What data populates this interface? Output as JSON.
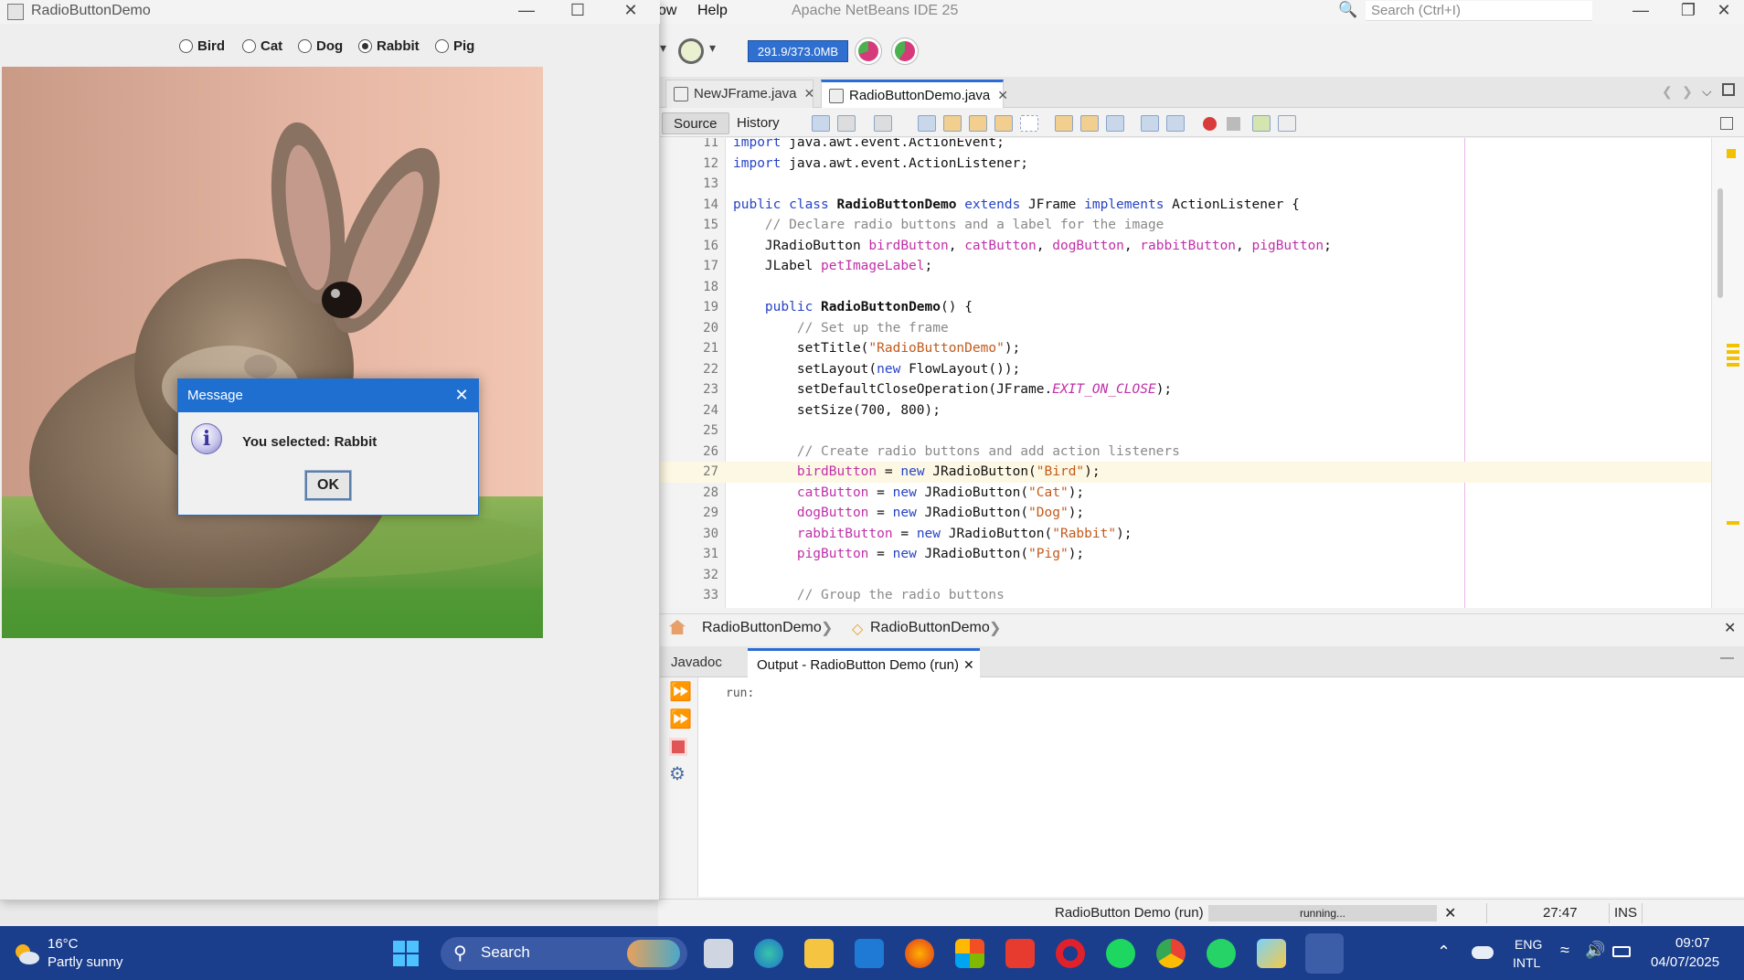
{
  "ide": {
    "menu": [
      "ow",
      "Help"
    ],
    "title": "Apache NetBeans IDE 25",
    "search_placeholder": "Search (Ctrl+I)",
    "memory": "291.9/373.0MB",
    "tabs": [
      {
        "label": "NewJFrame.java",
        "active": false
      },
      {
        "label": "RadioButtonDemo.java",
        "active": true
      }
    ],
    "editor_modes": {
      "source": "Source",
      "history": "History"
    },
    "code": [
      {
        "n": "11",
        "html": "<span class='kw'>import</span> java.awt.event.ActionEvent;"
      },
      {
        "n": "12",
        "html": "<span class='kw'>import</span> java.awt.event.ActionListener;"
      },
      {
        "n": "13",
        "html": ""
      },
      {
        "n": "14",
        "html": "<span class='kw'>public class</span> <span class='b'>RadioButtonDemo</span> <span class='kw'>extends</span> JFrame <span class='kw'>implements</span> ActionListener {"
      },
      {
        "n": "15",
        "html": "    <span class='cm'>// Declare radio buttons and a label for the image</span>"
      },
      {
        "n": "16",
        "html": "    JRadioButton <span class='fd'>birdButton</span>, <span class='fd'>catButton</span>, <span class='fd'>dogButton</span>, <span class='fd'>rabbitButton</span>, <span class='fd'>pigButton</span>;"
      },
      {
        "n": "17",
        "html": "    JLabel <span class='fd'>petImageLabel</span>;"
      },
      {
        "n": "18",
        "html": ""
      },
      {
        "n": "19",
        "html": "    <span class='kw'>public</span> <span class='b'>RadioButtonDemo</span>() {"
      },
      {
        "n": "20",
        "html": "        <span class='cm'>// Set up the frame</span>"
      },
      {
        "n": "21",
        "html": "        setTitle(<span class='st'>\"RadioButtonDemo\"</span>);"
      },
      {
        "n": "22",
        "html": "        setLayout(<span class='kw'>new</span> FlowLayout());"
      },
      {
        "n": "23",
        "html": "        setDefaultCloseOperation(JFrame.<span class='it'>EXIT_ON_CLOSE</span>);"
      },
      {
        "n": "24",
        "html": "        setSize(700, 800);"
      },
      {
        "n": "25",
        "html": ""
      },
      {
        "n": "26",
        "html": "        <span class='cm'>// Create radio buttons and add action listeners</span>"
      },
      {
        "n": "27",
        "html": "        <span class='fd'>birdButton</span> = <span class='kw'>new</span> JRadioButton(<span class='st'>\"Bird\"</span>);",
        "highlight": true
      },
      {
        "n": "28",
        "html": "        <span class='fd'>catButton</span> = <span class='kw'>new</span> JRadioButton(<span class='st'>\"Cat\"</span>);"
      },
      {
        "n": "29",
        "html": "        <span class='fd'>dogButton</span> = <span class='kw'>new</span> JRadioButton(<span class='st'>\"Dog\"</span>);"
      },
      {
        "n": "30",
        "html": "        <span class='fd'>rabbitButton</span> = <span class='kw'>new</span> JRadioButton(<span class='st'>\"Rabbit\"</span>);"
      },
      {
        "n": "31",
        "html": "        <span class='fd'>pigButton</span> = <span class='kw'>new</span> JRadioButton(<span class='st'>\"Pig\"</span>);"
      },
      {
        "n": "32",
        "html": ""
      },
      {
        "n": "33",
        "html": "        <span class='cm'>// Group the radio buttons</span>"
      }
    ],
    "breadcrumbs": [
      "RadioButtonDemo",
      "RadioButtonDemo"
    ],
    "output_tabs": [
      {
        "label": "Javadoc",
        "active": false
      },
      {
        "label": "Output - RadioButton Demo (run) ...",
        "active": true
      }
    ],
    "output_text": "run:",
    "status": {
      "task": "RadioButton Demo (run)",
      "progress_text": "running...",
      "position": "27:47",
      "mode": "INS"
    }
  },
  "demo": {
    "title": "RadioButtonDemo",
    "options": [
      {
        "label": "Bird",
        "selected": false
      },
      {
        "label": "Cat",
        "selected": false
      },
      {
        "label": "Dog",
        "selected": false
      },
      {
        "label": "Rabbit",
        "selected": true
      },
      {
        "label": "Pig",
        "selected": false
      }
    ],
    "image_icon": "rabbit-photo",
    "dialog": {
      "title": "Message",
      "message": "You selected: Rabbit",
      "ok_label": "OK"
    }
  },
  "taskbar": {
    "weather_temp": "16°C",
    "weather_desc": "Partly sunny",
    "search_label": "Search",
    "lang_top": "ENG",
    "lang_bottom": "INTL",
    "time": "09:07",
    "date": "04/07/2025",
    "apps": [
      "task-view",
      "edge",
      "file-explorer",
      "outlook",
      "firefox",
      "microsoft-store",
      "wps-office",
      "opera",
      "spotify",
      "chrome",
      "whatsapp",
      "vpn-app",
      "netbeans-java"
    ]
  },
  "colors": {
    "accent_blue": "#1f6fd1",
    "taskbar": "#1a3d8c",
    "keyword": "#2743c7",
    "field": "#c030a8",
    "string": "#c25a1c"
  }
}
